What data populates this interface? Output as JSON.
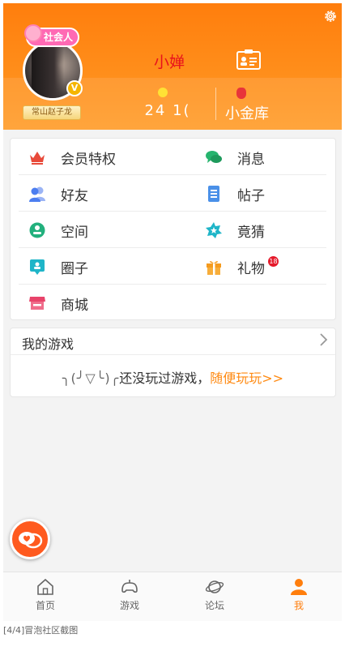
{
  "colors": {
    "accent": "#ff7e0d",
    "link": "#ff8a12",
    "username": "#e8121c",
    "badge": "#e5192a"
  },
  "profile": {
    "sticker": "社会人",
    "vip_badge": "V",
    "title": "常山赵子龙",
    "username": "小婵",
    "coins": "24",
    "coins_partial": "1(",
    "vault_label": "小金库"
  },
  "menu": {
    "items": [
      {
        "label": "会员特权",
        "icon": "crown-icon"
      },
      {
        "label": "消息",
        "icon": "chat-bubbles-icon"
      },
      {
        "label": "好友",
        "icon": "friends-icon"
      },
      {
        "label": "帖子",
        "icon": "document-icon"
      },
      {
        "label": "空间",
        "icon": "space-icon"
      },
      {
        "label": "竟猜",
        "icon": "star-badge-icon"
      },
      {
        "label": "圈子",
        "icon": "circle-group-icon"
      },
      {
        "label": "礼物",
        "icon": "gift-icon",
        "badge": "18"
      },
      {
        "label": "商城",
        "icon": "shop-icon"
      }
    ]
  },
  "games": {
    "title": "我的游戏",
    "empty_face": "╮(╯▽╰)╭",
    "empty_text": "还没玩过游戏，",
    "play_link": "随便玩玩>>"
  },
  "tabs": [
    {
      "label": "首页",
      "icon": "home-icon",
      "active": false
    },
    {
      "label": "游戏",
      "icon": "gamepad-icon",
      "active": false
    },
    {
      "label": "论坛",
      "icon": "planet-icon",
      "active": false
    },
    {
      "label": "我",
      "icon": "person-icon",
      "active": true
    }
  ],
  "caption": "[4/4]冒泡社区截图"
}
